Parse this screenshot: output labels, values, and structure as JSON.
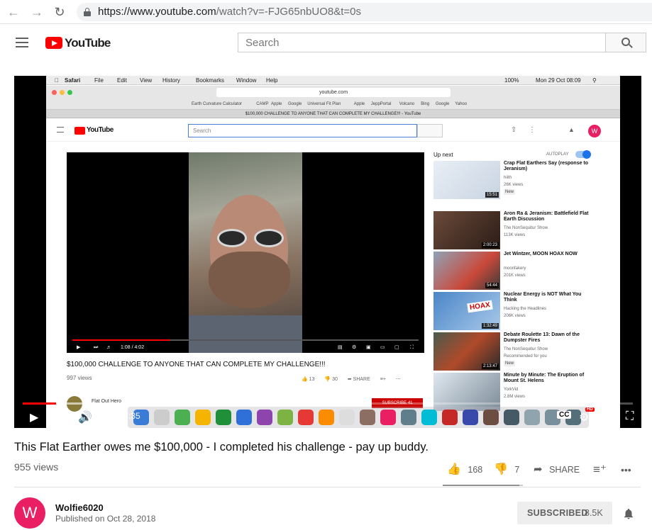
{
  "browser": {
    "url_host": "https://www.youtube.com",
    "url_path": "/watch?v=-FJG65nbUO8&t=0s"
  },
  "header": {
    "logo_text": "YouTube",
    "search_placeholder": "Search"
  },
  "embedded_screen": {
    "mac_menu": [
      "Safari",
      "File",
      "Edit",
      "View",
      "History",
      "Bookmarks",
      "Window",
      "Help"
    ],
    "mac_status": "Mon 29 Oct 08:09",
    "mac_battery": "100%",
    "address": "youtube.com",
    "favorites": [
      "Earth Curvature Calculator",
      "CAMP",
      "Apple",
      "Google",
      "Universal Fit Plan",
      "Apple",
      "JeppPortal",
      "Volcano",
      "Bing",
      "Google",
      "Yahoo"
    ],
    "tab_title": "$100,000 CHALLENGE TO ANYONE THAT CAN COMPLETE MY CHALLENGE!!! - YouTube",
    "yt_logo": "YouTube",
    "search_placeholder": "Search",
    "avatar_letter": "W",
    "player_time": "1:08 / 4:02",
    "player_progress": 0.28,
    "video_title": "$100,000 CHALLENGE TO ANYONE THAT CAN COMPLETE MY CHALLENGE!!!",
    "views": "997 views",
    "likes": "13",
    "dislikes": "30",
    "share": "SHARE",
    "channel": "Flat Out Hero",
    "subscribe": "SUBSCRIBE 41",
    "up_next": "Up next",
    "autoplay": "AUTOPLAY",
    "suggestions": [
      {
        "title": "Crap Flat Earthers Say (response to Jeranism)",
        "channel": "hiith",
        "views": "26K views",
        "badge": "New",
        "duration": "15:51"
      },
      {
        "title": "Aron Ra & Jeranism: Battlefield Flat Earth Discussion",
        "channel": "The NonSequitur Show",
        "views": "113K views",
        "badge": "",
        "duration": "2:00:23"
      },
      {
        "title": "Jet Wintzer, MOON HOAX NOW",
        "channel": "moonfakery",
        "views": "201K views",
        "badge": "",
        "duration": "54:44"
      },
      {
        "title": "Nuclear Energy is NOT What You Think",
        "channel": "Hacking the Headlines",
        "views": "206K views",
        "badge": "",
        "duration": "1:32:49",
        "thumb_text": "HOAX"
      },
      {
        "title": "Debate Roulette 13: Dawn of the Dumpster Fires",
        "channel": "The NonSequitur Show",
        "views": "Recommended for you",
        "badge": "New",
        "duration": "2:13:47"
      },
      {
        "title": "Minute by Minute: The Eruption of Mount St. Helens",
        "channel": "YorkVid",
        "views": "2.8M views",
        "badge": "",
        "duration": ""
      }
    ]
  },
  "player": {
    "time": "0:24 / 7:35",
    "progress": 0.055,
    "buffered": 0.2,
    "hd_badge": "HD",
    "cc_label": "CC"
  },
  "video": {
    "title": "This Flat Earther owes me $100,000 - I completed his challenge - pay up buddy.",
    "views": "955 views",
    "likes": "168",
    "dislikes": "7",
    "like_ratio": 0.96,
    "share_label": "SHARE",
    "more_label": "•••"
  },
  "channel": {
    "avatar_letter": "W",
    "name": "Wolfie6020",
    "published": "Published on Oct 28, 2018",
    "subscribe_label": "SUBSCRIBED",
    "subscriber_count": "8.5K"
  },
  "colors": {
    "brand_red": "#ff0000",
    "avatar": "#e91e63"
  }
}
